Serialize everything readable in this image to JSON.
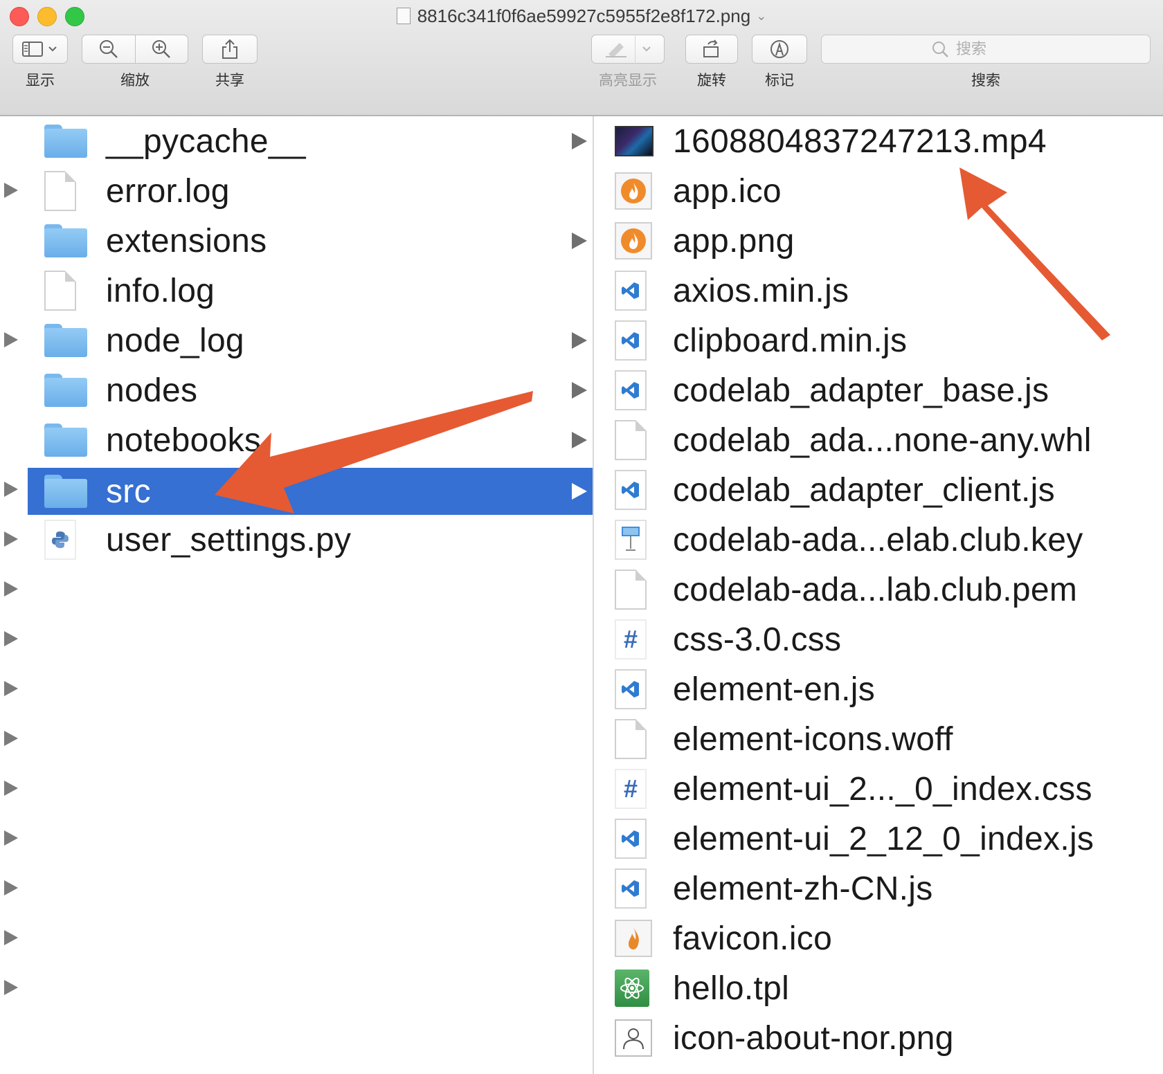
{
  "window": {
    "title": "8816c341f0f6ae59927c5955f2e8f172.png"
  },
  "toolbar": {
    "view_label": "显示",
    "zoom_label": "缩放",
    "share_label": "共享",
    "highlight_label": "高亮显示",
    "rotate_label": "旋转",
    "markup_label": "标记",
    "search_label": "搜索",
    "search_placeholder": "搜索"
  },
  "middle_column": {
    "items": [
      {
        "name": "__pycache__",
        "kind": "folder"
      },
      {
        "name": "error.log",
        "kind": "file"
      },
      {
        "name": "extensions",
        "kind": "folder"
      },
      {
        "name": "info.log",
        "kind": "file"
      },
      {
        "name": "node_log",
        "kind": "folder"
      },
      {
        "name": "nodes",
        "kind": "folder"
      },
      {
        "name": "notebooks",
        "kind": "folder"
      },
      {
        "name": "src",
        "kind": "folder",
        "selected": true
      },
      {
        "name": "user_settings.py",
        "kind": "python"
      }
    ]
  },
  "right_column": {
    "items": [
      {
        "name": "1608804837247213.mp4",
        "icon": "video-icon"
      },
      {
        "name": "app.ico",
        "icon": "flame-icon"
      },
      {
        "name": "app.png",
        "icon": "flame-icon"
      },
      {
        "name": "axios.min.js",
        "icon": "vscode-icon"
      },
      {
        "name": "clipboard.min.js",
        "icon": "vscode-icon"
      },
      {
        "name": "codelab_adapter_base.js",
        "icon": "vscode-icon"
      },
      {
        "name": "codelab_ada...none-any.whl",
        "icon": "document-icon"
      },
      {
        "name": "codelab_adapter_client.js",
        "icon": "vscode-icon"
      },
      {
        "name": "codelab-ada...elab.club.key",
        "icon": "keynote-icon"
      },
      {
        "name": "codelab-ada...lab.club.pem",
        "icon": "document-icon"
      },
      {
        "name": "css-3.0.css",
        "icon": "css-icon"
      },
      {
        "name": "element-en.js",
        "icon": "vscode-icon"
      },
      {
        "name": "element-icons.woff",
        "icon": "document-icon"
      },
      {
        "name": "element-ui_2..._0_index.css",
        "icon": "css-icon"
      },
      {
        "name": "element-ui_2_12_0_index.js",
        "icon": "vscode-icon"
      },
      {
        "name": "element-zh-CN.js",
        "icon": "vscode-icon"
      },
      {
        "name": "favicon.ico",
        "icon": "flame-icon"
      },
      {
        "name": "hello.tpl",
        "icon": "atom-icon"
      },
      {
        "name": "icon-about-nor.png",
        "icon": "person-icon"
      }
    ]
  },
  "colors": {
    "selection": "#3570d2",
    "annotation_arrow": "#e55a33",
    "folder": "#79b8ef"
  }
}
